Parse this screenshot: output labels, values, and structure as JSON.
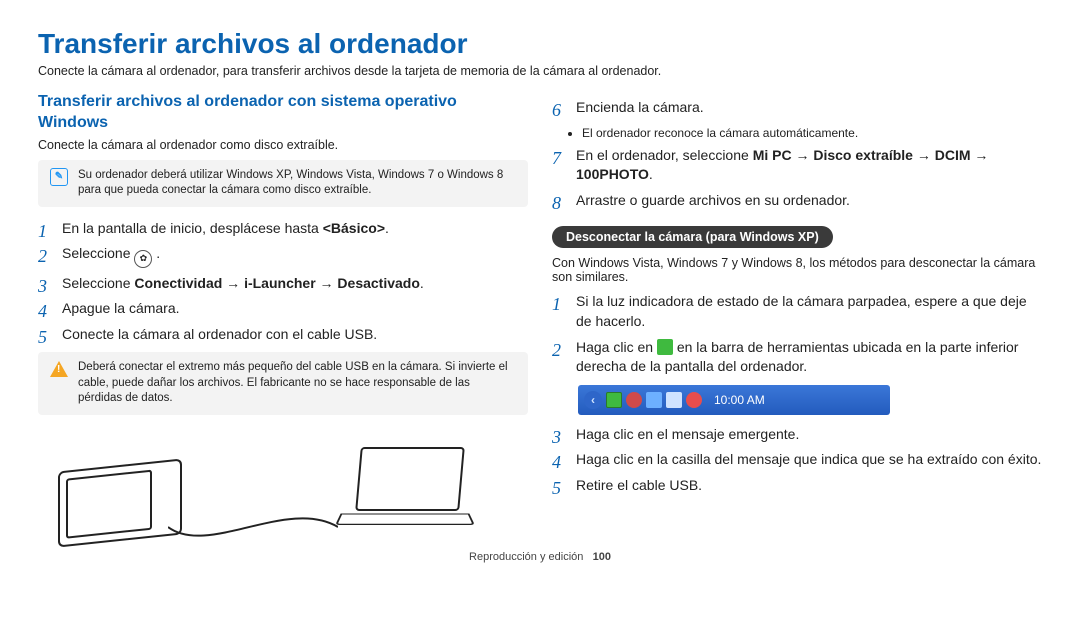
{
  "page": {
    "title": "Transferir archivos al ordenador",
    "intro": "Conecte la cámara al ordenador, para transferir archivos desde la tarjeta de memoria de la cámara al ordenador.",
    "footer_section": "Reproducción y edición",
    "footer_page": "100"
  },
  "left": {
    "subtitle": "Transferir archivos al ordenador con sistema operativo Windows",
    "para": "Conecte la cámara al ordenador como disco extraíble.",
    "note": "Su ordenador deberá utilizar Windows XP, Windows Vista, Windows 7 o Windows 8 para que pueda conectar la cámara como disco extraíble.",
    "steps": [
      {
        "html": "En la pantalla de inicio, desplácese hasta <b>&lt;Básico&gt;</b>."
      },
      {
        "html": "Seleccione <span class='inline-icon' data-name='settings-wheel-icon' data-interactable='false'>✿</span> ."
      },
      {
        "html": "Seleccione <b>Conectividad → i-Launcher → Desactivado</b>."
      },
      {
        "html": "Apague la cámara."
      },
      {
        "html": "Conecte la cámara al ordenador con el cable USB."
      }
    ],
    "warn": "Deberá conectar el extremo más pequeño del cable USB en la cámara. Si invierte el cable, puede dañar los archivos. El fabricante no se hace responsable de las pérdidas de datos."
  },
  "right": {
    "steps_first": [
      {
        "n": 6,
        "html": "Encienda la cámara."
      },
      {
        "n": 7,
        "html": "En el ordenador, seleccione <b>Mi PC → Disco extraíble → DCIM → 100PHOTO</b>."
      },
      {
        "n": 8,
        "html": "Arrastre o guarde archivos en su ordenador."
      }
    ],
    "bullet_after_6": "El ordenador reconoce la cámara automáticamente.",
    "pill": "Desconectar la cámara (para Windows XP)",
    "pill_para": "Con Windows Vista, Windows 7 y Windows 8, los métodos para desconectar la cámara son similares.",
    "steps_disconnect": [
      {
        "html": "Si la luz indicadora de estado de la cámara parpadea, espere a que deje de hacerlo."
      },
      {
        "html": "Haga clic en <span class='green-inline' data-name='safe-remove-icon' data-interactable='false'></span> en la barra de herramientas ubicada en la parte inferior derecha de la pantalla del ordenador."
      },
      {
        "html": "Haga clic en el mensaje emergente."
      },
      {
        "html": "Haga clic en la casilla del mensaje que indica que se ha extraído con éxito."
      },
      {
        "html": "Retire el cable USB."
      }
    ],
    "taskbar_clock": "10:00 AM"
  }
}
